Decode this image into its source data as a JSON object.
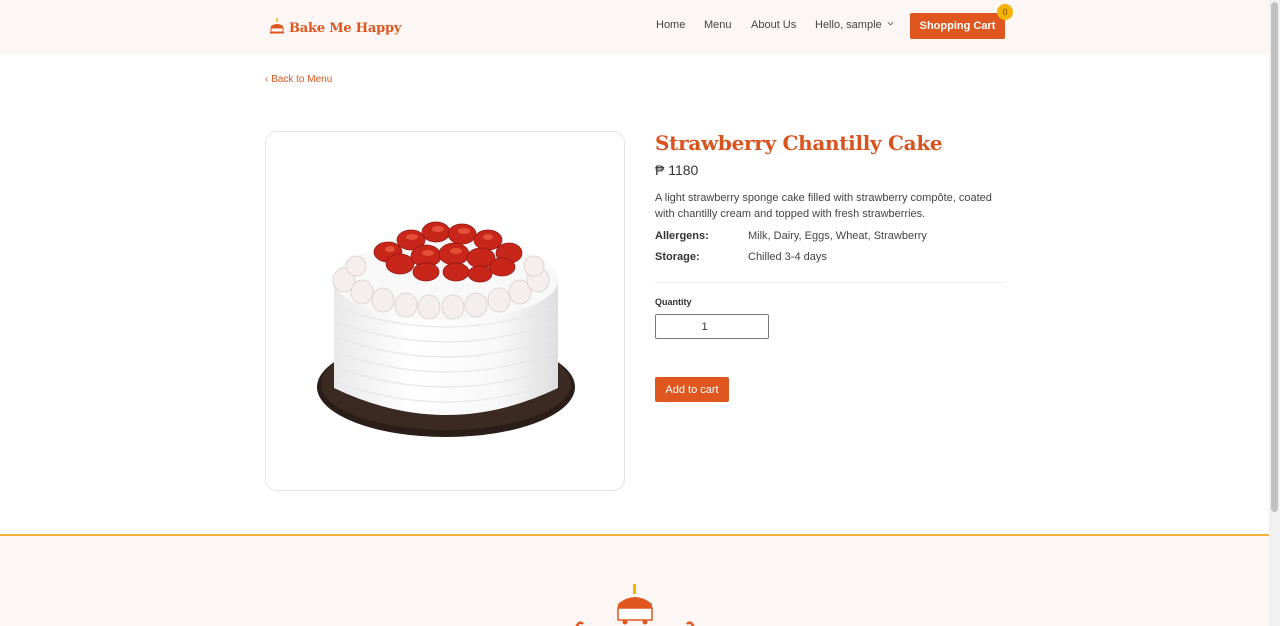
{
  "header": {
    "brand": "Bake Me Happy",
    "nav": {
      "home": "Home",
      "menu": "Menu",
      "about": "About Us",
      "greeting": "Hello, sample"
    },
    "cart_label": "Shopping Cart",
    "cart_count": "0"
  },
  "back_link": "‹ Back to Menu",
  "product": {
    "name": "Strawberry Chantilly Cake",
    "price": "₱ 1180",
    "description": "A light strawberry sponge cake filled with strawberry compôte, coated with chantilly cream and topped with fresh strawberries.",
    "allergens_label": "Allergens:",
    "allergens": "Milk, Dairy, Eggs, Wheat, Strawberry",
    "storage_label": "Storage:",
    "storage": "Chilled 3-4 days",
    "quantity_label": "Quantity",
    "quantity": "1",
    "add_to_cart": "Add to cart"
  },
  "colors": {
    "accent": "#e0561f",
    "badge": "#f6b400",
    "footer_border": "#f2b13a"
  }
}
